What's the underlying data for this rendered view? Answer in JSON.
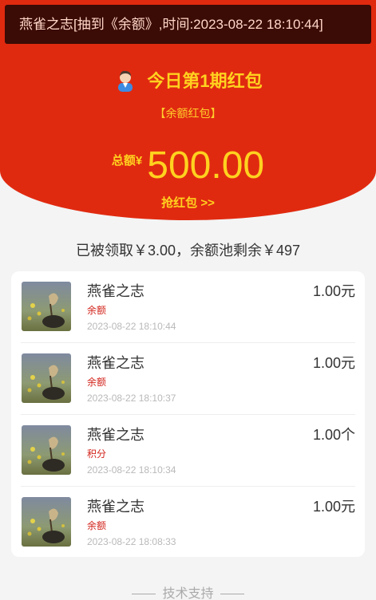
{
  "ticker": {
    "text": "燕雀之志[抽到《余额》,时间:2023-08-22 18:10:44]"
  },
  "header": {
    "title": "今日第1期红包",
    "subtitle": "【余额红包】",
    "amount_label": "总额¥",
    "amount_value": "500.00",
    "grab_label": "抢红包 >>"
  },
  "summary": {
    "text": "已被领取￥3.00，余额池剩余￥497"
  },
  "records": [
    {
      "name": "燕雀之志",
      "kind": "余额",
      "time": "2023-08-22 18:10:44",
      "amount": "1.00元"
    },
    {
      "name": "燕雀之志",
      "kind": "余额",
      "time": "2023-08-22 18:10:37",
      "amount": "1.00元"
    },
    {
      "name": "燕雀之志",
      "kind": "积分",
      "time": "2023-08-22 18:10:34",
      "amount": "1.00个"
    },
    {
      "name": "燕雀之志",
      "kind": "余额",
      "time": "2023-08-22 18:08:33",
      "amount": "1.00元"
    }
  ],
  "footer": {
    "text": "技术支持"
  },
  "colors": {
    "hero_bg": "#e02a10",
    "accent_yellow": "#ffd21f",
    "kind_red": "#d2231a"
  }
}
